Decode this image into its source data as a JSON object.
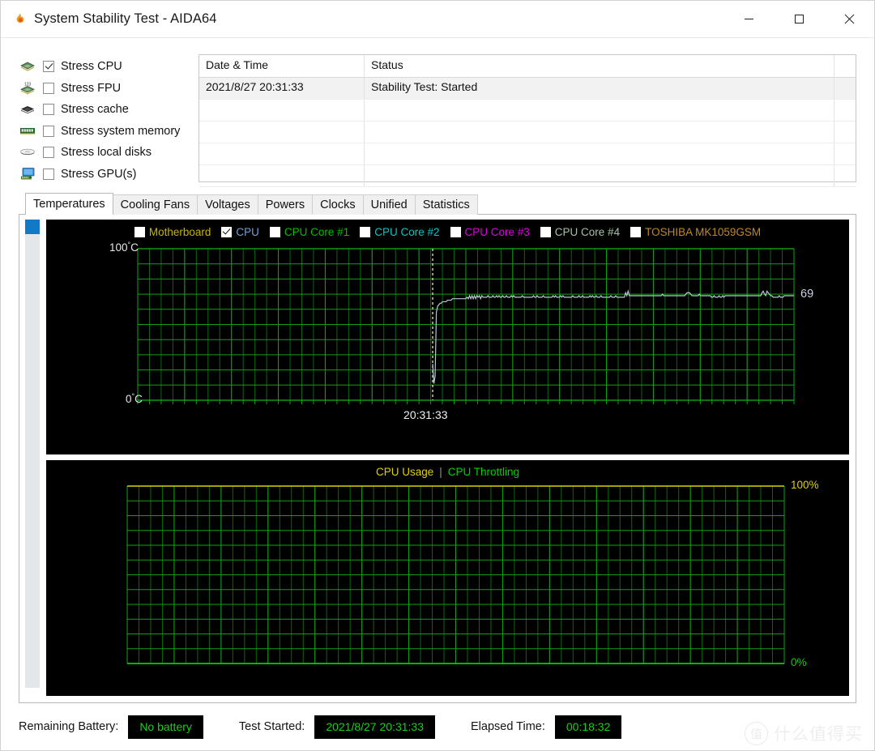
{
  "window": {
    "title": "System Stability Test - AIDA64",
    "icon": "flame-icon",
    "controls": {
      "minimize": "minimize-icon",
      "maximize": "maximize-icon",
      "close": "close-icon"
    }
  },
  "stress_options": [
    {
      "label": "Stress CPU",
      "checked": true,
      "icon": "cpu-chip-icon"
    },
    {
      "label": "Stress FPU",
      "checked": false,
      "icon": "fpu-chip-icon"
    },
    {
      "label": "Stress cache",
      "checked": false,
      "icon": "cache-chip-icon"
    },
    {
      "label": "Stress system memory",
      "checked": false,
      "icon": "memory-module-icon"
    },
    {
      "label": "Stress local disks",
      "checked": false,
      "icon": "hard-disk-icon"
    },
    {
      "label": "Stress GPU(s)",
      "checked": false,
      "icon": "gpu-monitor-icon"
    }
  ],
  "log_table": {
    "columns": [
      "Date & Time",
      "Status"
    ],
    "rows": [
      {
        "datetime": "2021/8/27 20:31:33",
        "status": "Stability Test: Started"
      }
    ],
    "empty_rows": 4
  },
  "tabs": [
    {
      "label": "Temperatures",
      "active": true
    },
    {
      "label": "Cooling Fans",
      "active": false
    },
    {
      "label": "Voltages",
      "active": false
    },
    {
      "label": "Powers",
      "active": false
    },
    {
      "label": "Clocks",
      "active": false
    },
    {
      "label": "Unified",
      "active": false
    },
    {
      "label": "Statistics",
      "active": false
    }
  ],
  "chart_data": [
    {
      "type": "line",
      "name": "temperature-chart",
      "title": "",
      "ylabel_top": "100",
      "ylabel_bottom": "0",
      "unit": "°C",
      "ylim": [
        0,
        100
      ],
      "grid": true,
      "legend_position": "top",
      "time_marker_label": "20:31:33",
      "current_value_label": "69",
      "legend": [
        {
          "name": "Motherboard",
          "color": "#c8b400",
          "checked": false
        },
        {
          "name": "CPU",
          "color": "#6ea0d8",
          "checked": true
        },
        {
          "name": "CPU Core #1",
          "color": "#00c000",
          "checked": false
        },
        {
          "name": "CPU Core #2",
          "color": "#00c8c8",
          "checked": false
        },
        {
          "name": "CPU Core #3",
          "color": "#e000e0",
          "checked": false
        },
        {
          "name": "CPU Core #4",
          "color": "#a8c0a8",
          "checked": false
        },
        {
          "name": "TOSHIBA MK1059GSM",
          "color": "#c08828",
          "checked": false
        }
      ],
      "series": [
        {
          "name": "CPU",
          "color": "#b9c6d8",
          "values": [
            0,
            0,
            0,
            0,
            0,
            0,
            0,
            0,
            0,
            0,
            0,
            0,
            0,
            0,
            0,
            0,
            0,
            0,
            0,
            0,
            0,
            0,
            0,
            0,
            0,
            0,
            0,
            0,
            0,
            0,
            0,
            0,
            0,
            0,
            0,
            0,
            0,
            0,
            0,
            0,
            0,
            0,
            0,
            0,
            0,
            0,
            0,
            0,
            0,
            0,
            0,
            0,
            0,
            0,
            0,
            0,
            0,
            0,
            0,
            0,
            0,
            0,
            0,
            0,
            0,
            0,
            0,
            0,
            0,
            0,
            0,
            0,
            0,
            0,
            0,
            0,
            0,
            0,
            0,
            0,
            0,
            0,
            0,
            0,
            0,
            0,
            0,
            0,
            0,
            0,
            0,
            0,
            0,
            0,
            0,
            0,
            0,
            0,
            0,
            0,
            0,
            0,
            0,
            0,
            0,
            0,
            0,
            0,
            0,
            0,
            0,
            0,
            0,
            0,
            0,
            0,
            0,
            0,
            0,
            0,
            0,
            0,
            0,
            0,
            0,
            0,
            0,
            0,
            0,
            0,
            0,
            0,
            0,
            0,
            0,
            0,
            0,
            0,
            0,
            0,
            0,
            0,
            0,
            0,
            0,
            0,
            0,
            0,
            0,
            0,
            0,
            0,
            0,
            0,
            0,
            0,
            0,
            0,
            0,
            0,
            0,
            0,
            0,
            0,
            0,
            0,
            0,
            0,
            0,
            0,
            0,
            0,
            0,
            0,
            0,
            0,
            0,
            0,
            0,
            0,
            0,
            0,
            0,
            0,
            0,
            0,
            0,
            0,
            0,
            0,
            0,
            0,
            0,
            0,
            0,
            0,
            0,
            0,
            0,
            0,
            0,
            0,
            0,
            0,
            0,
            0,
            0,
            0,
            0,
            0,
            0,
            0,
            0,
            0,
            0,
            0,
            0,
            0,
            0,
            0,
            0,
            0,
            0,
            0,
            0,
            0,
            0,
            0,
            0,
            0,
            0,
            0,
            0,
            0,
            0,
            0,
            0,
            0,
            0,
            0,
            24,
            11,
            16,
            58,
            62,
            63,
            64,
            64,
            65,
            65,
            65,
            65,
            66,
            66,
            66,
            66,
            67,
            67,
            67,
            67,
            67,
            67,
            67,
            67,
            67,
            67,
            67,
            67,
            68,
            67,
            69,
            67,
            69,
            67,
            69,
            67,
            69,
            68,
            69,
            67,
            69,
            68,
            68,
            68,
            68,
            69,
            68,
            68,
            68,
            69,
            68,
            68,
            69,
            68,
            69,
            68,
            68,
            69,
            68,
            68,
            69,
            68,
            68,
            68,
            69,
            68,
            69,
            68,
            68,
            68,
            68,
            68,
            68,
            69,
            68,
            68,
            68,
            68,
            68,
            68,
            68,
            68,
            69,
            68,
            68,
            69,
            68,
            68,
            68,
            68,
            69,
            68,
            68,
            68,
            68,
            68,
            68,
            68,
            69,
            68,
            69,
            68,
            68,
            68,
            69,
            68,
            69,
            68,
            68,
            68,
            68,
            68,
            68,
            68,
            69,
            68,
            68,
            68,
            68,
            69,
            68,
            68,
            69,
            68,
            68,
            68,
            68,
            68,
            69,
            68,
            69,
            68,
            68,
            69,
            68,
            68,
            68,
            69,
            68,
            68,
            68,
            68,
            68,
            68,
            68,
            69,
            68,
            68,
            68,
            69,
            68,
            68,
            68,
            68,
            68,
            68,
            68,
            71,
            69,
            72,
            69,
            69,
            69,
            69,
            69,
            69,
            69,
            69,
            69,
            69,
            69,
            69,
            69,
            69,
            69,
            69,
            69,
            69,
            69,
            69,
            69,
            69,
            69,
            69,
            69,
            69,
            69,
            70,
            69,
            69,
            69,
            69,
            69,
            69,
            69,
            69,
            69,
            69,
            69,
            69,
            69,
            69,
            69,
            69,
            69,
            69,
            70,
            71,
            71,
            71,
            70,
            69,
            69,
            69,
            69,
            69,
            69,
            70,
            69,
            69,
            69,
            69,
            69,
            69,
            69,
            69,
            69,
            68,
            68,
            69,
            68,
            68,
            68,
            69,
            68,
            68,
            69,
            68,
            69,
            69,
            69,
            69,
            69,
            69,
            69,
            69,
            69,
            69,
            69,
            69,
            69,
            69,
            69,
            69,
            69,
            69,
            69,
            69,
            69,
            69,
            69,
            69,
            69,
            69,
            69,
            69,
            69,
            69,
            71,
            72,
            70,
            69,
            72,
            71,
            70,
            69,
            69,
            68,
            68,
            68,
            68,
            68,
            69,
            68,
            68,
            68,
            69,
            69,
            69,
            69,
            69,
            69,
            69,
            69,
            69
          ]
        }
      ]
    },
    {
      "type": "line",
      "name": "cpu-usage-chart",
      "title": "",
      "ylabel_top_left": "100%",
      "ylabel_bottom_left": "0%",
      "ylabel_top_right": "100%",
      "ylabel_bottom_right": "0%",
      "ylim": [
        0,
        100
      ],
      "grid": true,
      "legend_position": "top",
      "legend": [
        {
          "name": "CPU Usage",
          "color": "#e0d000"
        },
        {
          "name": "CPU Throttling",
          "color": "#00d000"
        }
      ],
      "series": [
        {
          "name": "CPU Usage",
          "color": "#e0d000",
          "constant_value": 100
        },
        {
          "name": "CPU Throttling",
          "color": "#00d000",
          "constant_value": 0
        }
      ]
    }
  ],
  "statusbar": {
    "battery_label": "Remaining Battery:",
    "battery_value": "No battery",
    "started_label": "Test Started:",
    "started_value": "2021/8/27 20:31:33",
    "elapsed_label": "Elapsed Time:",
    "elapsed_value": "00:18:32"
  },
  "watermark": {
    "mark": "值",
    "text": "什么值得买"
  }
}
